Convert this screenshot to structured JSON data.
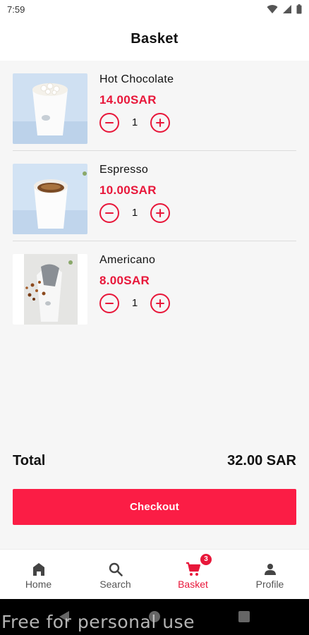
{
  "status_bar": {
    "time": "7:59",
    "icons": [
      "wifi-icon",
      "signal-icon",
      "battery-icon"
    ]
  },
  "header": {
    "title": "Basket"
  },
  "basket": {
    "items": [
      {
        "name": "Hot Chocolate",
        "price": "14.00SAR",
        "quantity": "1",
        "image": "hot-chocolate-cup-image"
      },
      {
        "name": "Espresso",
        "price": "10.00SAR",
        "quantity": "1",
        "image": "espresso-cup-image"
      },
      {
        "name": "Americano",
        "price": "8.00SAR",
        "quantity": "1",
        "image": "americano-cup-image"
      }
    ]
  },
  "summary": {
    "total_label": "Total",
    "total_value": "32.00 SAR"
  },
  "checkout": {
    "label": "Checkout"
  },
  "bottom_nav": {
    "items": [
      {
        "label": "Home",
        "icon": "home-icon",
        "active": false
      },
      {
        "label": "Search",
        "icon": "search-icon",
        "active": false
      },
      {
        "label": "Basket",
        "icon": "cart-icon",
        "active": true,
        "badge": "3"
      },
      {
        "label": "Profile",
        "icon": "person-icon",
        "active": false
      }
    ]
  },
  "watermark": {
    "text": "Free for personal use"
  },
  "colors": {
    "accent": "#e8173a",
    "checkout": "#fb1d45",
    "background": "#f6f6f6"
  }
}
